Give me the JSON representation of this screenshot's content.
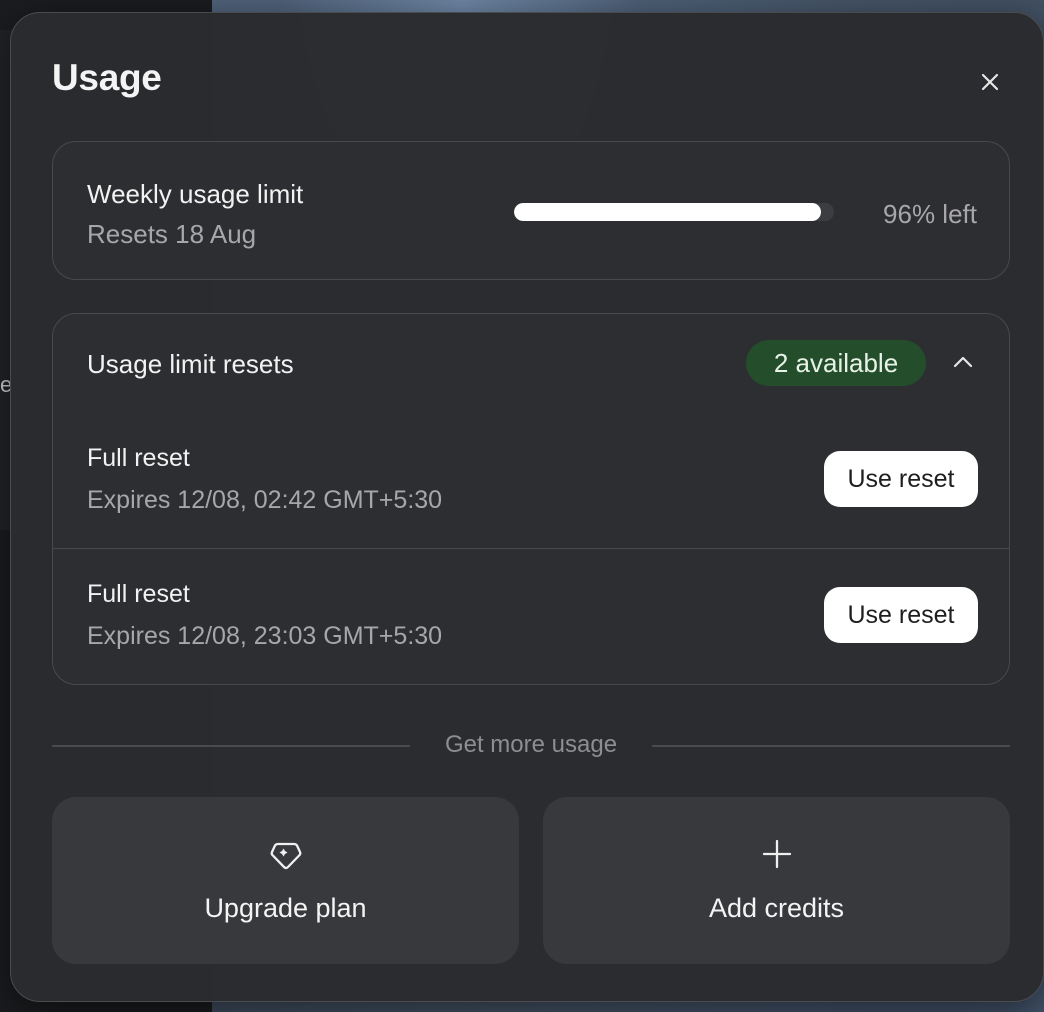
{
  "background": {
    "partial_letter": "e"
  },
  "modal": {
    "title": "Usage",
    "close_icon": "close-icon"
  },
  "weekly_limit": {
    "title": "Weekly usage limit",
    "resets": "Resets 18 Aug",
    "percent_left": 96,
    "percent_label": "96% left"
  },
  "resets": {
    "title": "Usage limit resets",
    "badge": "2 available",
    "badge_color": "#244e2b",
    "toggle_icon": "chevron-up-icon",
    "items": [
      {
        "name": "Full reset",
        "expiry": "Expires 12/08, 02:42 GMT+5:30",
        "button": "Use reset"
      },
      {
        "name": "Full reset",
        "expiry": "Expires 12/08, 23:03 GMT+5:30",
        "button": "Use reset"
      }
    ]
  },
  "more_usage": {
    "divider_label": "Get more usage",
    "actions": [
      {
        "icon": "tag-icon",
        "label": "Upgrade plan"
      },
      {
        "icon": "plus-icon",
        "label": "Add credits"
      }
    ]
  }
}
